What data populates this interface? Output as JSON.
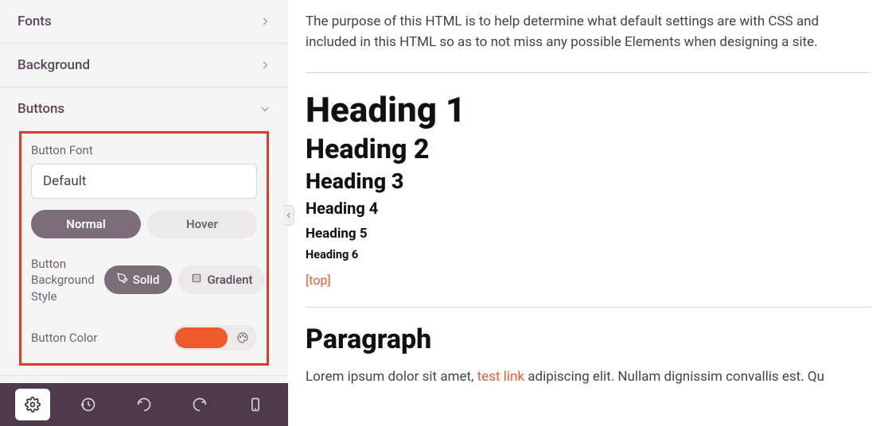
{
  "sidebar": {
    "sections": {
      "fonts": {
        "label": "Fonts"
      },
      "background": {
        "label": "Background"
      },
      "buttons": {
        "label": "Buttons",
        "button_font_label": "Button Font",
        "button_font_value": "Default",
        "tabs": {
          "normal": "Normal",
          "hover": "Hover",
          "active": "normal"
        },
        "bg_style_label": "Button Background Style",
        "bg_style": {
          "solid": "Solid",
          "gradient": "Gradient",
          "active": "solid"
        },
        "button_color_label": "Button Color",
        "button_color_value": "#ef5a2b"
      }
    }
  },
  "toolbar": {
    "items": [
      "settings",
      "history",
      "undo",
      "redo",
      "responsive"
    ],
    "active": "settings"
  },
  "preview": {
    "intro": "The purpose of this HTML is to help determine what default settings are with CSS and included in this HTML so as to not miss any possible Elements when designing a site.",
    "h1": "Heading 1",
    "h2": "Heading 2",
    "h3": "Heading 3",
    "h4": "Heading 4",
    "h5": "Heading 5",
    "h6": "Heading 6",
    "top_link": "[top]",
    "paragraph_heading": "Paragraph",
    "body_before": "Lorem ipsum dolor sit amet, ",
    "body_link": "test link",
    "body_after": " adipiscing elit. Nullam dignissim convallis est. Qu"
  }
}
